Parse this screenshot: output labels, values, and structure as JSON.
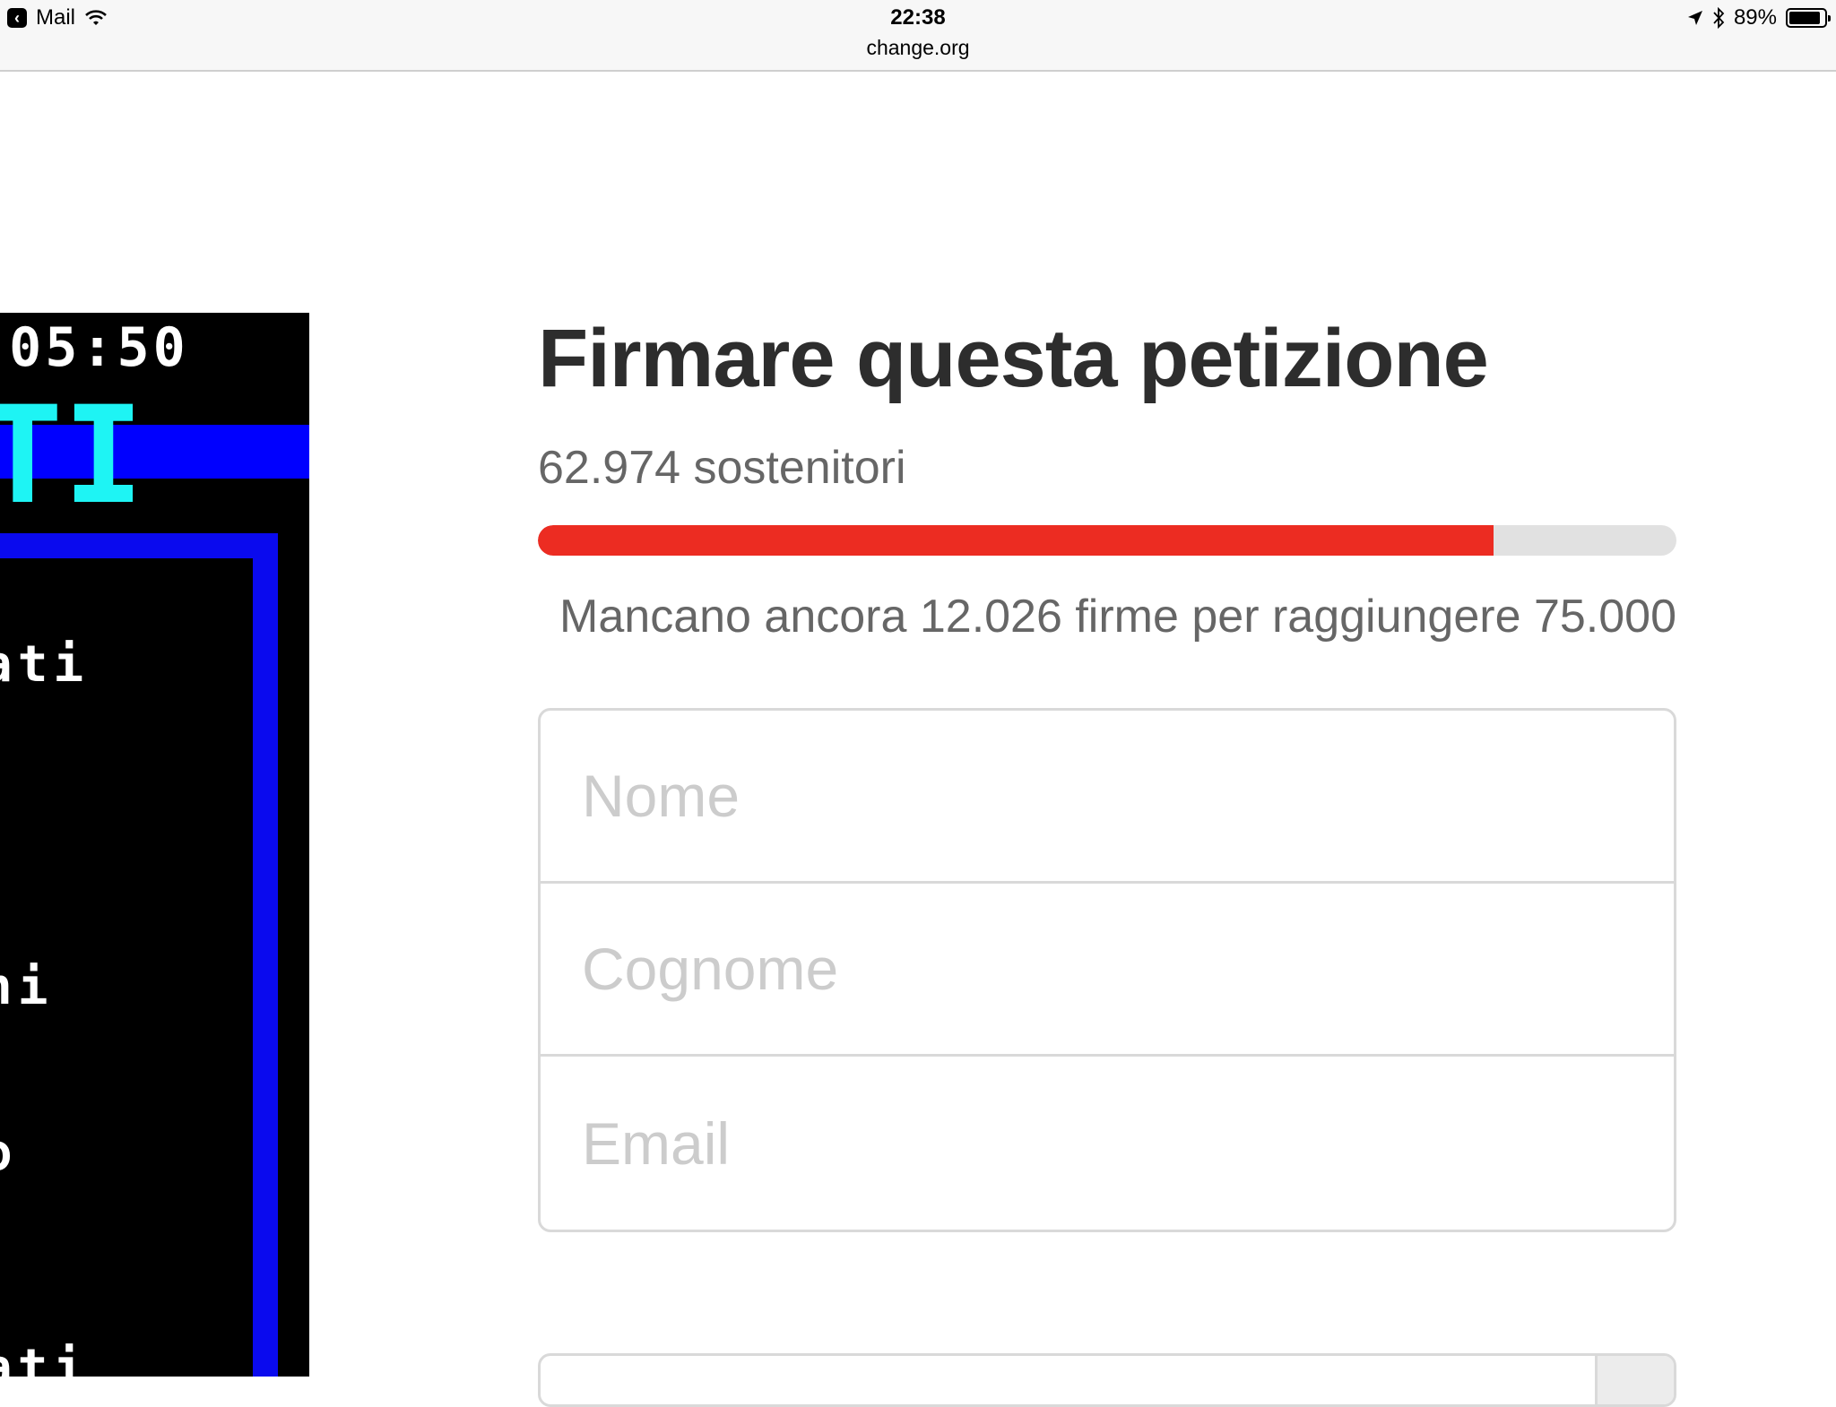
{
  "status_bar": {
    "back_app": "Mail",
    "time": "22:38",
    "url": "change.org",
    "battery_text": "89%",
    "battery_level": 0.89
  },
  "petition_image": {
    "clock_text": ":05:50",
    "logo_text": "TI",
    "lines": [
      "ati",
      "ni",
      "o",
      "ati"
    ]
  },
  "sign_panel": {
    "title": "Firmare questa petizione",
    "supporters_text": "62.974 sostenitori",
    "signatures": 62974,
    "goal": 75000,
    "remaining_text": "Mancano ancora 12.026 firme per raggiungere 75.000",
    "progress_color": "#ec2c22",
    "fields": [
      {
        "placeholder": "Nome"
      },
      {
        "placeholder": "Cognome"
      },
      {
        "placeholder": "Email"
      }
    ]
  }
}
